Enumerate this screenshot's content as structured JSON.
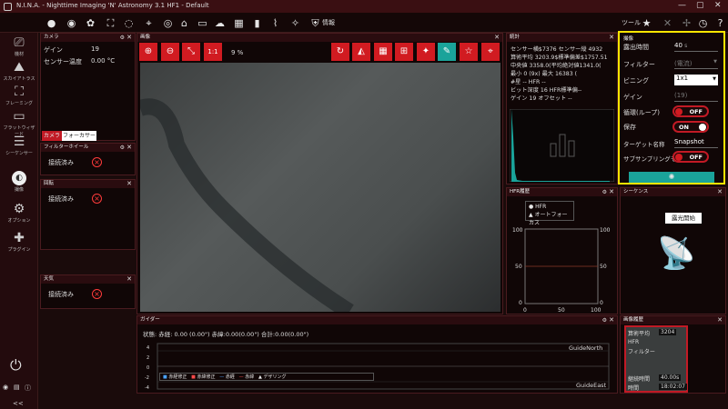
{
  "window": {
    "title": "N.I.N.A. - Nighttime Imaging 'N' Astronomy 3.1 HF1  -  Default"
  },
  "toolbar": {
    "info_label": "情報",
    "tools_label": "ツール"
  },
  "sidebar": {
    "items": [
      {
        "label": "機材",
        "icon": "camera-icon"
      },
      {
        "label": "スカイアトラス",
        "icon": "sky-atlas-icon"
      },
      {
        "label": "フレーミング",
        "icon": "framing-icon"
      },
      {
        "label": "フラットウィザード",
        "icon": "flat-wizard-icon"
      },
      {
        "label": "シーケンサー",
        "icon": "sequencer-icon"
      },
      {
        "label": "撮像",
        "icon": "imaging-icon"
      },
      {
        "label": "オプション",
        "icon": "gear-icon"
      },
      {
        "label": "プラグイン",
        "icon": "puzzle-icon"
      }
    ]
  },
  "camera_panel": {
    "title": "カメラ",
    "rows": [
      {
        "k": "ゲイン",
        "v": "19"
      },
      {
        "k": "センサー温度",
        "v": "0.00 °C"
      }
    ],
    "tab_camera": "カメラ",
    "tab_focuser": "フォーカサー"
  },
  "filterwheel_panel": {
    "title": "フィルターホイール",
    "status": "接続済み"
  },
  "rotator_panel": {
    "title": "回転",
    "status": "接続済み"
  },
  "weather_panel": {
    "title": "天気",
    "status": "接続済み"
  },
  "image_panel": {
    "title": "画像",
    "zoom_label": "1:1",
    "zoom_pct": "9 %"
  },
  "stats_panel": {
    "title": "統計",
    "lines": [
      "センサー横$7376    センサー縦  4932",
      "算術平均  3203.9$標準偏差$1757.51",
      "中央値     3358.0(平均絶対値1341.0(",
      "最小      0 (9x)   最大       16383 (",
      "#星       --       HFR        --",
      "ビット深度 16      HFR標準偏--",
      "ゲイン     19      オフセット --"
    ]
  },
  "hfr_panel": {
    "title": "HFR履歴",
    "legend_hfr": "HFR",
    "legend_af": "オートフォーカス",
    "y_labels": [
      "100",
      "50",
      "0"
    ],
    "x_labels": [
      "0",
      "50",
      "100"
    ],
    "right_labels": [
      "100",
      "50",
      "0"
    ]
  },
  "sequence_panel": {
    "title": "シーケンス",
    "tooltip": "露光開始"
  },
  "imaging_panel": {
    "title": "撮像",
    "exposure_label": "露出時間",
    "exposure_value": "40",
    "exposure_unit": "s",
    "filter_label": "フィルター",
    "filter_value": "(電流)",
    "binning_label": "ビニング",
    "binning_value": "1x1",
    "gain_label": "ゲイン",
    "gain_value": "(19)",
    "loop_label": "循環(ループ)",
    "loop_state": "OFF",
    "save_label": "保存",
    "save_state": "ON",
    "target_label": "ターゲット名称",
    "target_value": "Snapshot",
    "subsample_label": "サブサンプリングモ",
    "subsample_state": "OFF"
  },
  "guider_panel": {
    "title": "ガイダー",
    "status": "状態:  赤経: 0.00 (0.00\")  赤緯:0.00(0.00\")  合計:0.00(0.00\")",
    "north_label": "GuideNorth",
    "east_label": "GuideEast",
    "legend": [
      "赤経修正",
      "赤緯修正",
      "赤経",
      "赤緯",
      "デザリング"
    ],
    "y_labels": [
      "4",
      "3",
      "2",
      "1",
      "0",
      "-1",
      "-2",
      "-3",
      "-4"
    ]
  },
  "history_panel": {
    "title": "画像履歴",
    "mean_label": "算術平均",
    "mean_value": "3204",
    "hfr_label": "HFR",
    "filter_label": "フィルター",
    "exposure_label": "継続時間",
    "exposure_value": "40.00s",
    "time_label": "時間",
    "time_value": "18:02:07"
  },
  "colors": {
    "accent": "#d11b21",
    "highlight": "#ffe600",
    "teal": "#1aa39a"
  }
}
